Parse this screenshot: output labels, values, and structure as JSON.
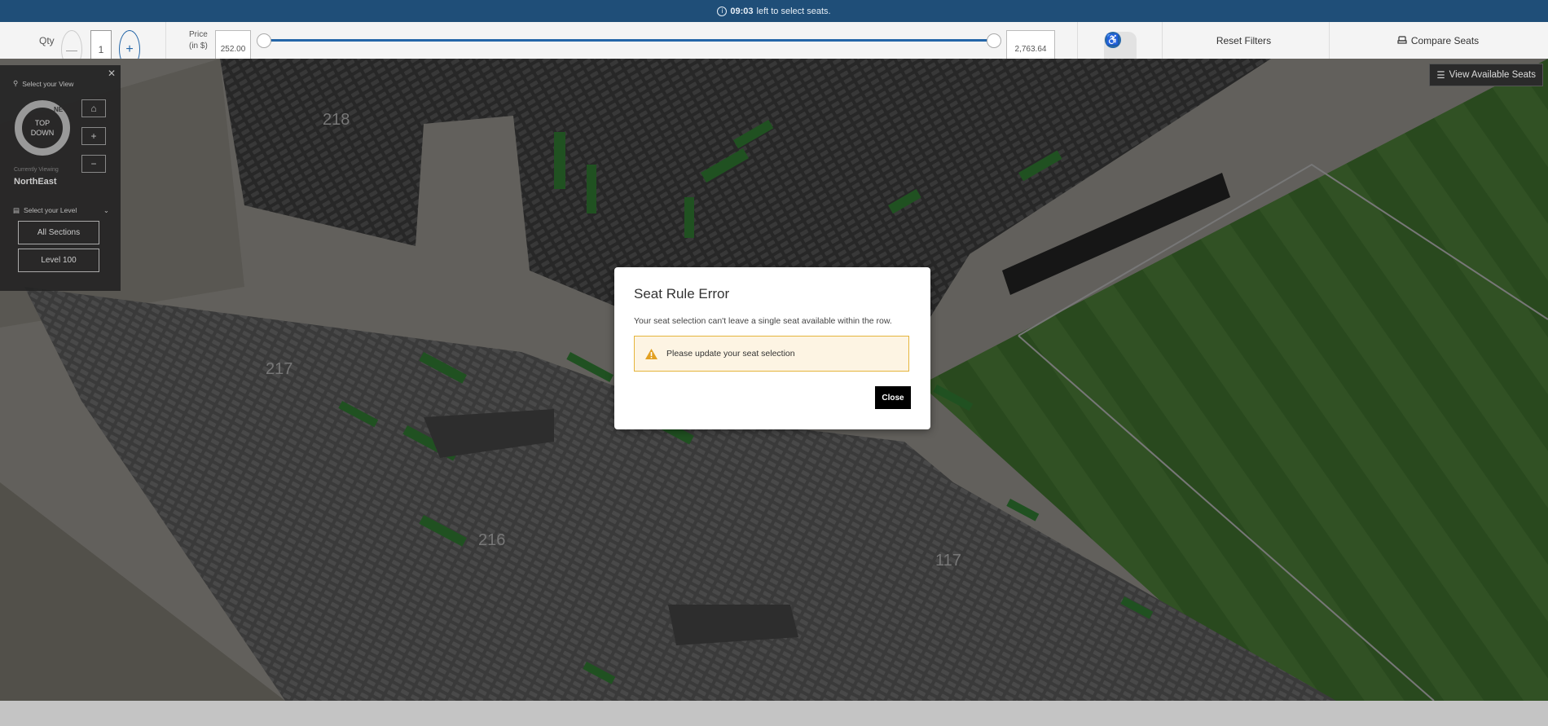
{
  "timer": {
    "time": "09:03",
    "message": "left to select seats."
  },
  "toolbar": {
    "qty_label": "Qty",
    "qty_value": "1",
    "qty_minus": "—",
    "qty_plus": "+",
    "price_label": "Price",
    "price_unit": "(in $)",
    "price_min": "252.00",
    "price_max": "2,763.64",
    "reset_label": "Reset Filters",
    "compare_label": "Compare Seats",
    "accessibility_icon": "♿"
  },
  "map": {
    "view_available_label": "View Available Seats",
    "sections": [
      "218",
      "217",
      "216",
      "117"
    ]
  },
  "panel": {
    "select_view_label": "Select your View",
    "compass_text": "TOP DOWN",
    "compass_direction": "NE",
    "facing_label": "Currently Viewing",
    "facing_value": "NorthEast",
    "select_level_label": "Select your Level",
    "levels": [
      "All Sections",
      "Level 100"
    ],
    "home_icon": "⌂",
    "zoom_in": "+",
    "zoom_out": "−"
  },
  "modal": {
    "title": "Seat Rule Error",
    "message": "Your seat selection can't leave a single seat available within the row.",
    "alert_text": "Please update your seat selection",
    "close_label": "Close"
  },
  "colors": {
    "timer_bg": "#1f4e78",
    "accent": "#2466a8",
    "alert_bg": "#fdf4e3",
    "alert_border": "#e5b43c",
    "available_seat": "#3d9a3f"
  }
}
